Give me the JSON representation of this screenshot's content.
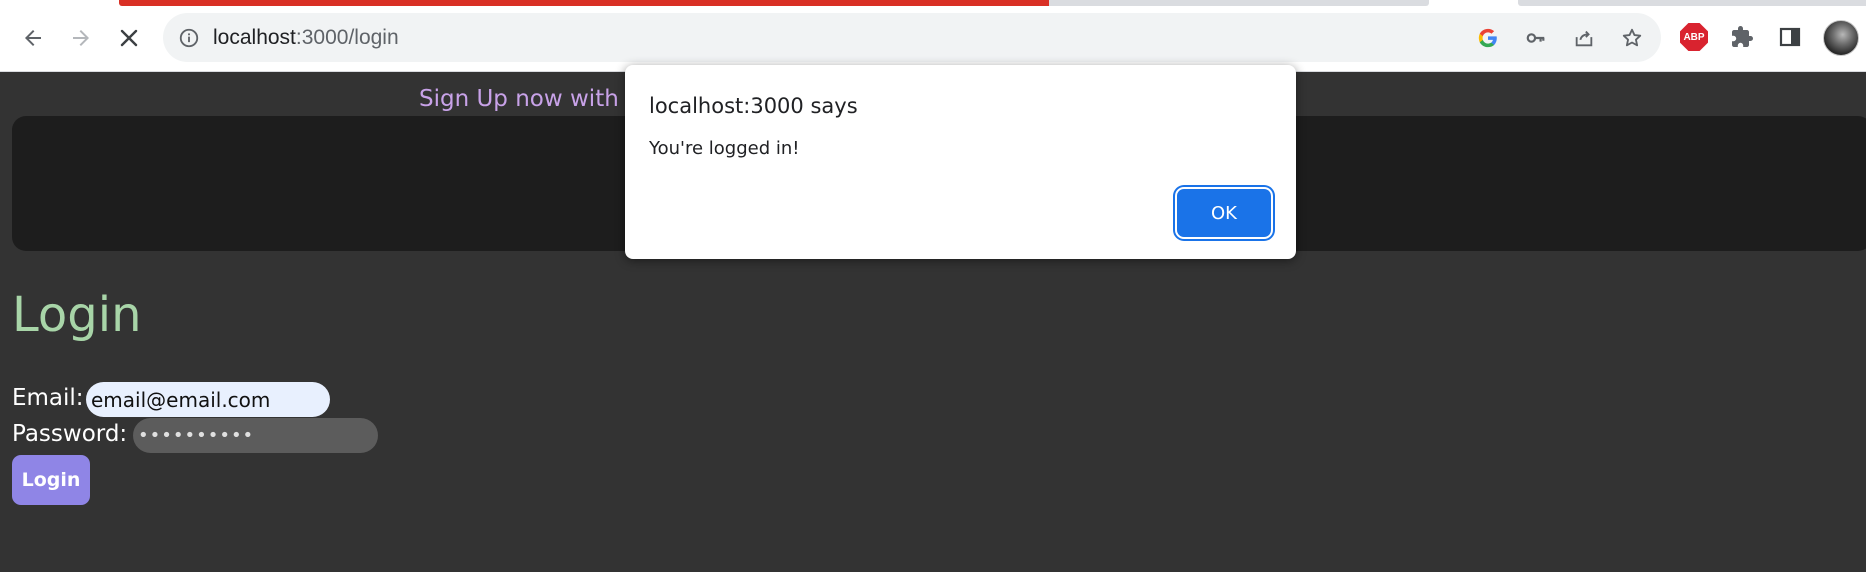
{
  "browser": {
    "url_host": "localhost",
    "url_path": ":3000/login",
    "loading_progress": 0.71,
    "colors": {
      "progress": "#d93025",
      "abp": "#d9232f"
    },
    "abp_label": "ABP",
    "icons": [
      "back-arrow-icon",
      "forward-arrow-icon",
      "stop-loading-icon",
      "site-info-icon",
      "google-icon",
      "key-icon",
      "share-icon",
      "star-icon",
      "abp-icon",
      "puzzle-extensions-icon",
      "side-panel-icon",
      "profile-avatar"
    ]
  },
  "page": {
    "signup_text": "Sign Up now with y",
    "title": "Login",
    "email_label": "Email:",
    "email_value": "email@email.com",
    "password_label": "Password:",
    "password_value": "••••••••••",
    "login_button": "Login",
    "colors": {
      "background": "#333333",
      "title": "#a8d5a8",
      "signup": "#c8a2e8",
      "button": "#8f85e6"
    }
  },
  "dialog": {
    "title": "localhost:3000 says",
    "message": "You're logged in!",
    "ok_label": "OK",
    "colors": {
      "ok_button": "#1a73e8"
    }
  }
}
